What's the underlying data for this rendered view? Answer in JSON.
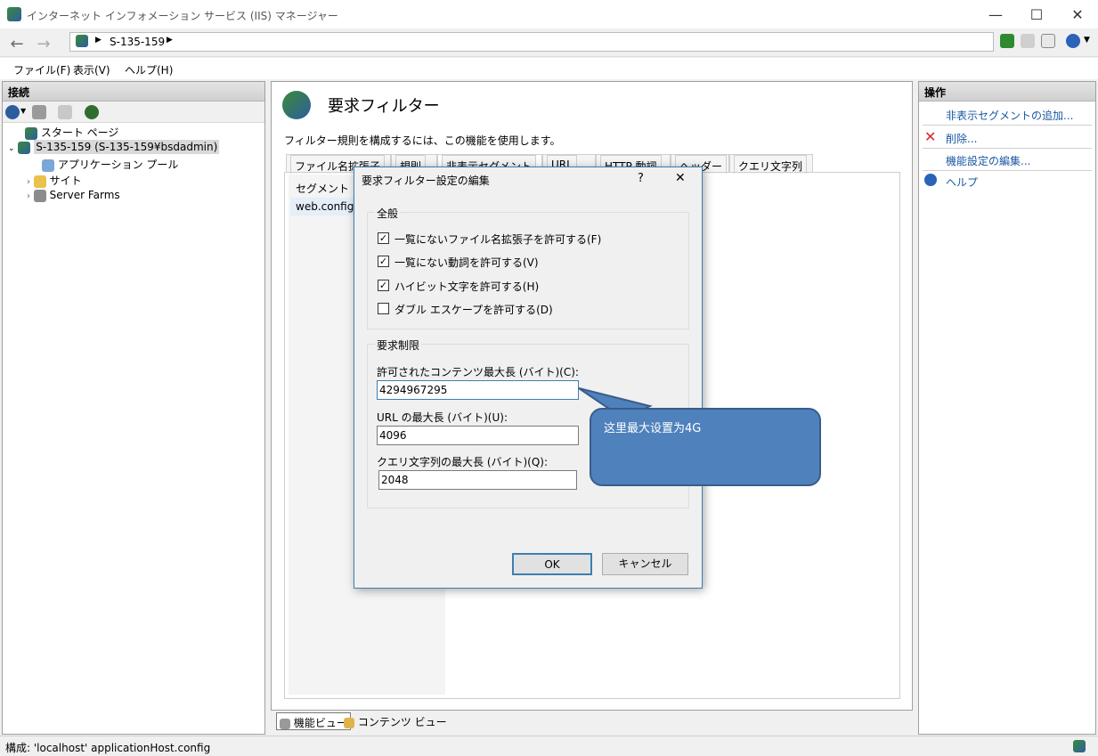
{
  "window": {
    "title": "インターネット インフォメーション サービス (IIS) マネージャー"
  },
  "address": {
    "crumb": "S-135-159"
  },
  "menu": [
    "ファイル(F)",
    "表示(V)",
    "ヘルプ(H)"
  ],
  "connections": {
    "header": "接続",
    "items": [
      "スタート ページ",
      "S-135-159 (S-135-159¥bsdadmin)",
      "アプリケーション プール",
      "サイト",
      "Server Farms"
    ]
  },
  "feature": {
    "title": "要求フィルター",
    "description": "フィルター規則を構成するには、この機能を使用します。",
    "tabs": [
      "ファイル名拡張子",
      "規則",
      "非表示セグメント",
      "URL",
      "HTTP 動詞",
      "ヘッダー",
      "クエリ文字列"
    ],
    "list_header": "セグメント",
    "list_item": "web.config"
  },
  "dialog": {
    "title": "要求フィルター設定の編集",
    "help": "?",
    "close": "✕",
    "general_label": "全般",
    "checks": [
      {
        "label": "一覧にないファイル名拡張子を許可する(F)",
        "mark": "✓"
      },
      {
        "label": "一覧にない動詞を許可する(V)",
        "mark": "✓"
      },
      {
        "label": "ハイビット文字を許可する(H)",
        "mark": "✓"
      },
      {
        "label": "ダブル エスケープを許可する(D)",
        "mark": ""
      }
    ],
    "limits_label": "要求制限",
    "content_len_label": "許可されたコンテンツ最大長 (バイト)(C):",
    "content_len_value": "4294967295",
    "url_len_label": "URL の最大長 (バイト)(U):",
    "url_len_value": "4096",
    "query_len_label": "クエリ文字列の最大長 (バイト)(Q):",
    "query_len_value": "2048",
    "ok": "OK",
    "cancel": "キャンセル"
  },
  "callout": {
    "text": "这里最大设置为4G",
    "fill": "#4f81bd"
  },
  "actions": {
    "header": "操作",
    "items": [
      "非表示セグメントの追加...",
      "削除...",
      "機能設定の編集...",
      "ヘルプ"
    ]
  },
  "views": {
    "features": "機能ビュー",
    "content": "コンテンツ ビュー"
  },
  "status": {
    "text": "構成: 'localhost' applicationHost.config"
  },
  "colors": {
    "accent": "#3c7fb1",
    "link": "#1a57a3"
  }
}
